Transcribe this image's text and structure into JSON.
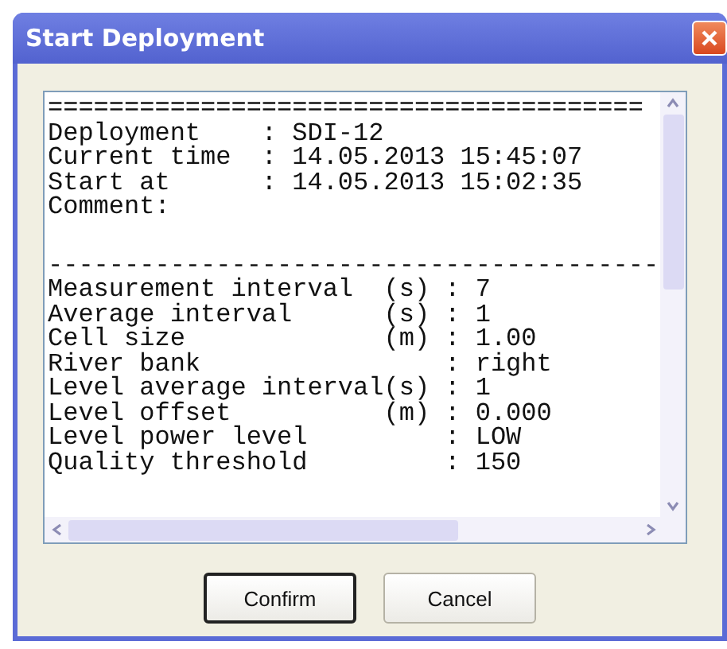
{
  "window": {
    "title": "Start Deployment"
  },
  "report": {
    "sections": [
      {
        "lines": [
          "=======================================",
          "Deployment    : SDI-12",
          "Current time  : 14.05.2013 15:45:07",
          "Start at      : 14.05.2013 15:02:35",
          "Comment:"
        ]
      },
      {
        "lines": [
          "----------------------------------------",
          "Measurement interval  (s) : 7",
          "Average interval      (s) : 1",
          "Cell size             (m) : 1.00",
          "River bank                : right",
          "Level average interval(s) : 1",
          "Level offset          (m) : 0.000",
          "Level power level         : LOW",
          "Quality threshold         : 150"
        ]
      }
    ]
  },
  "buttons": [
    {
      "label": "Confirm",
      "default": true
    },
    {
      "label": "Cancel",
      "default": false
    }
  ]
}
